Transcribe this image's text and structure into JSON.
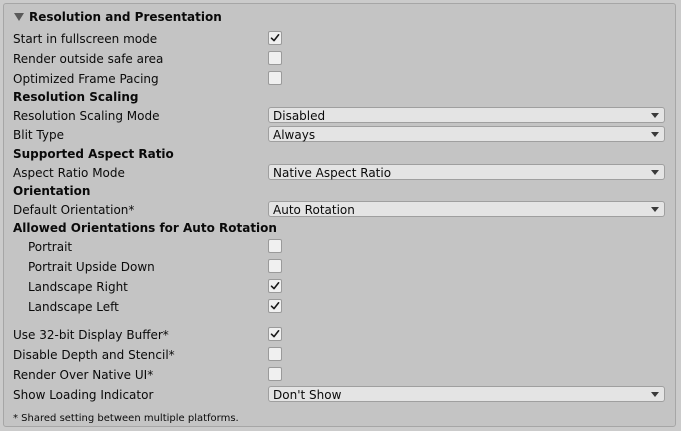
{
  "section": {
    "title": "Resolution and Presentation",
    "fullscreen": {
      "label": "Start in fullscreen mode",
      "checked": true
    },
    "render_outside_safe_area": {
      "label": "Render outside safe area",
      "checked": false
    },
    "optimized_frame_pacing": {
      "label": "Optimized Frame Pacing",
      "checked": false
    },
    "resolution_scaling": {
      "header": "Resolution Scaling",
      "mode_label": "Resolution Scaling Mode",
      "mode_value": "Disabled",
      "blit_label": "Blit Type",
      "blit_value": "Always"
    },
    "aspect_ratio": {
      "header": "Supported Aspect Ratio",
      "mode_label": "Aspect Ratio Mode",
      "mode_value": "Native Aspect Ratio"
    },
    "orientation": {
      "header": "Orientation",
      "default_label": "Default Orientation*",
      "default_value": "Auto Rotation",
      "allowed_header": "Allowed Orientations for Auto Rotation",
      "portrait": {
        "label": "Portrait",
        "checked": false
      },
      "portrait_upside_down": {
        "label": "Portrait Upside Down",
        "checked": false
      },
      "landscape_right": {
        "label": "Landscape Right",
        "checked": true
      },
      "landscape_left": {
        "label": "Landscape Left",
        "checked": true
      }
    },
    "display_buffer": {
      "label": "Use 32-bit Display Buffer*",
      "checked": true
    },
    "disable_depth_stencil": {
      "label": "Disable Depth and Stencil*",
      "checked": false
    },
    "render_over_native_ui": {
      "label": "Render Over Native UI*",
      "checked": false
    },
    "loading_indicator": {
      "label": "Show Loading Indicator",
      "value": "Don't Show"
    },
    "footnote": "* Shared setting between multiple platforms."
  },
  "colors": {
    "panel": "#c4c4c4",
    "checkbox": "#f0f0f0",
    "dropdown": "#e4e4e4"
  },
  "icons": {
    "foldout": "triangle-down-icon",
    "check": "checkmark-icon",
    "dropdown": "chevron-down-icon"
  }
}
